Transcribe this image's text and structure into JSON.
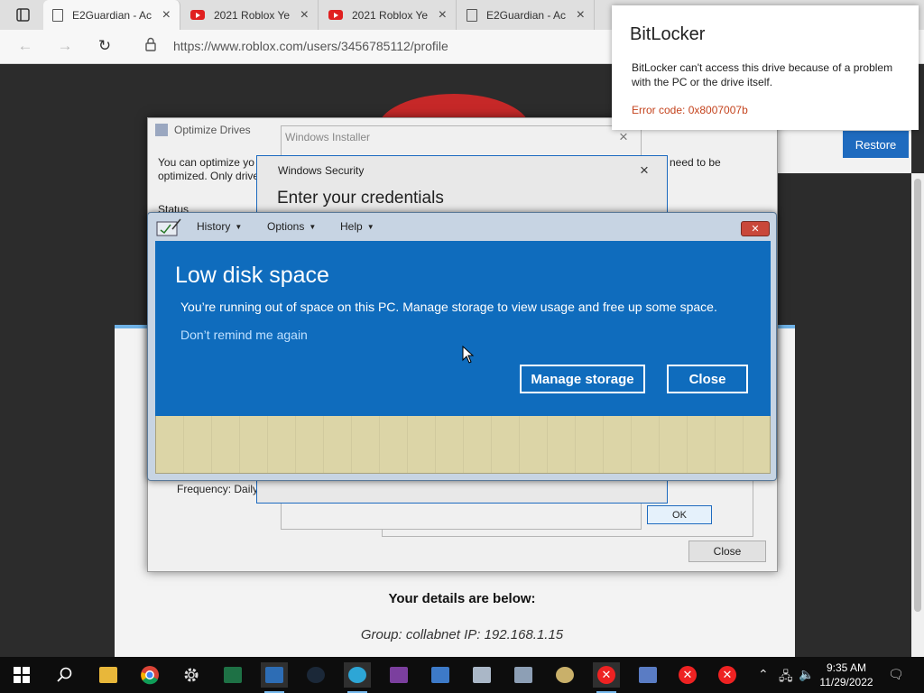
{
  "browser": {
    "tabs": [
      {
        "label": "E2Guardian - Ac",
        "icon": "page-icon"
      },
      {
        "label": "2021 Roblox Ye",
        "icon": "youtube-icon"
      },
      {
        "label": "2021 Roblox Ye",
        "icon": "youtube-icon"
      },
      {
        "label": "E2Guardian - Ac",
        "icon": "page-icon"
      }
    ],
    "url": "https://www.roblox.com/users/3456785112/profile"
  },
  "page": {
    "restore_label": "Restore",
    "details_title": "Your details are below:",
    "details_line": "Group: collabnet   IP: 192.168.1.15"
  },
  "optimize": {
    "title": "Optimize Drives",
    "desc": "You can optimize yo optimized. Only drive",
    "desc2": "need to be",
    "status": "Status",
    "frequency": "Frequency: Daily",
    "close_label": "Close"
  },
  "installer": {
    "title": "Windows Installer",
    "ok_label": "OK"
  },
  "security": {
    "title": "Windows Security",
    "heading": "Enter your credentials"
  },
  "lowdisk": {
    "menu": [
      "History",
      "Options",
      "Help"
    ],
    "heading": "Low disk space",
    "message": "You’re running out of space on this PC. Manage storage to view usage and free up some space.",
    "dont_remind": "Don’t remind me again",
    "manage_label": "Manage storage",
    "close_label": "Close",
    "accent": "#0f6cbd"
  },
  "bitlocker": {
    "title": "BitLocker",
    "body": "BitLocker can't access this drive because of a problem with the PC or the drive itself.",
    "error": "Error code: 0x8007007b",
    "error_color": "#c4431d"
  },
  "taskbar": {
    "time": "9:35 AM",
    "date": "11/29/2022"
  }
}
